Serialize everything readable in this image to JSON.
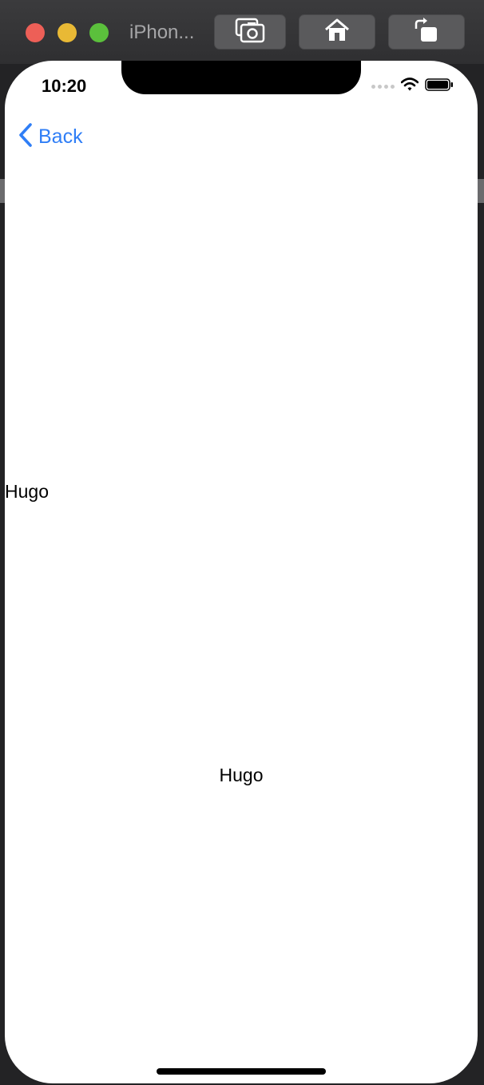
{
  "window": {
    "title": "iPhon...",
    "buttons": {
      "screenshot": "screenshot-icon",
      "home": "home-icon",
      "rotate": "rotate-icon"
    }
  },
  "status_bar": {
    "time": "10:20"
  },
  "nav": {
    "back_label": "Back"
  },
  "content": {
    "label_left": "Hugo",
    "label_center": "Hugo"
  },
  "colors": {
    "accent": "#2f7ef6",
    "screen_bg": "#ffffff",
    "chrome": "#3b3b3d"
  }
}
